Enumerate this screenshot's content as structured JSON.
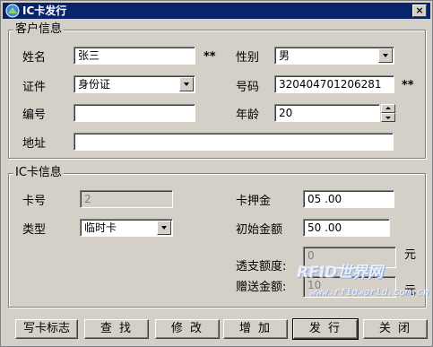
{
  "window": {
    "title": "IC卡发行",
    "close": "×"
  },
  "customer": {
    "legend": "客户信息",
    "name_label": "姓名",
    "name_value": "张三",
    "name_required": "**",
    "gender_label": "性别",
    "gender_value": "男",
    "id_label": "证件",
    "id_type": "身份证",
    "idno_label": "号码",
    "idno_value": "320404701206281",
    "idno_required": "**",
    "code_label": "编号",
    "code_value": "",
    "age_label": "年龄",
    "age_value": "20",
    "address_label": "地址",
    "address_value": ""
  },
  "card": {
    "legend": "IC卡信息",
    "cardno_label": "卡号",
    "cardno_value": "2",
    "deposit_label": "卡押金",
    "deposit_value": "05 .00",
    "type_label": "类型",
    "type_value": "临时卡",
    "initial_label": "初始金额",
    "initial_value": "50  .00",
    "overdraft_label": "透支额度:",
    "overdraft_value": "0",
    "overdraft_unit": "元",
    "gift_label": "赠送金额:",
    "gift_value": "10",
    "gift_unit": "元"
  },
  "buttons": {
    "write_flag": "写卡标志",
    "search": "查 找",
    "modify": "修 改",
    "add": "增 加",
    "issue": "发 行",
    "close": "关 闭"
  },
  "watermark": {
    "logo": "RFID世界网",
    "url": "www.rfidworld.com.cn"
  }
}
